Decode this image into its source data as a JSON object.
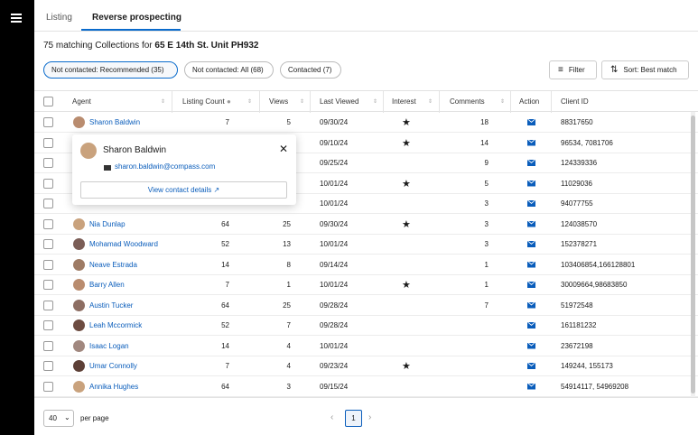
{
  "nav": {
    "menu_icon": "hamburger-icon"
  },
  "tabs": [
    {
      "label": "Listing",
      "active": false
    },
    {
      "label": "Reverse prospecting",
      "active": true
    }
  ],
  "summary": {
    "prefix": "75 matching Collections for",
    "address": "65 E 14th St. Unit PH932"
  },
  "filters": [
    {
      "label": "Not contacted: Recommended (35)",
      "active": true
    },
    {
      "label": "Not contacted: All (68)",
      "active": false
    },
    {
      "label": "Contacted (7)",
      "active": false
    }
  ],
  "toolbar": {
    "filter_label": "Filter",
    "sort_label": "Sort: Best match"
  },
  "columns": {
    "agent": "Agent",
    "listing_count": "Listing Count",
    "views": "Views",
    "last_viewed": "Last Viewed",
    "interest": "Interest",
    "comments": "Comments",
    "action": "Action",
    "client_id": "Client ID"
  },
  "rows": [
    {
      "agent": "Sharon Baldwin",
      "listing_count": "7",
      "views": "5",
      "last_viewed": "09/30/24",
      "interest": true,
      "comments": "18",
      "client_id": "88317650"
    },
    {
      "agent": "",
      "listing_count": "",
      "views": "",
      "last_viewed": "09/10/24",
      "interest": true,
      "comments": "14",
      "client_id": "96534, 7081706"
    },
    {
      "agent": "",
      "listing_count": "",
      "views": "",
      "last_viewed": "09/25/24",
      "interest": false,
      "comments": "9",
      "client_id": "124339336"
    },
    {
      "agent": "",
      "listing_count": "",
      "views": "",
      "last_viewed": "10/01/24",
      "interest": true,
      "comments": "5",
      "client_id": "11029036"
    },
    {
      "agent": "",
      "listing_count": "",
      "views": "",
      "last_viewed": "10/01/24",
      "interest": false,
      "comments": "3",
      "client_id": "94077755"
    },
    {
      "agent": "Nia Dunlap",
      "listing_count": "64",
      "views": "25",
      "last_viewed": "09/30/24",
      "interest": true,
      "comments": "3",
      "client_id": "124038570"
    },
    {
      "agent": "Mohamad Woodward",
      "listing_count": "52",
      "views": "13",
      "last_viewed": "10/01/24",
      "interest": false,
      "comments": "3",
      "client_id": "152378271"
    },
    {
      "agent": "Neave Estrada",
      "listing_count": "14",
      "views": "8",
      "last_viewed": "09/14/24",
      "interest": false,
      "comments": "1",
      "client_id": "103406854,166128801"
    },
    {
      "agent": "Barry Allen",
      "listing_count": "7",
      "views": "1",
      "last_viewed": "10/01/24",
      "interest": true,
      "comments": "1",
      "client_id": "30009664,98683850"
    },
    {
      "agent": "Austin Tucker",
      "listing_count": "64",
      "views": "25",
      "last_viewed": "09/28/24",
      "interest": false,
      "comments": "7",
      "client_id": "51972548"
    },
    {
      "agent": "Leah Mccormick",
      "listing_count": "52",
      "views": "7",
      "last_viewed": "09/28/24",
      "interest": false,
      "comments": "",
      "client_id": "161181232"
    },
    {
      "agent": "Isaac Logan",
      "listing_count": "14",
      "views": "4",
      "last_viewed": "10/01/24",
      "interest": false,
      "comments": "",
      "client_id": "23672198"
    },
    {
      "agent": "Umar Connolly",
      "listing_count": "7",
      "views": "4",
      "last_viewed": "09/23/24",
      "interest": true,
      "comments": "",
      "client_id": "149244, 155173"
    },
    {
      "agent": "Annika Hughes",
      "listing_count": "64",
      "views": "3",
      "last_viewed": "09/15/24",
      "interest": false,
      "comments": "",
      "client_id": "54914117, 54969208"
    }
  ],
  "popover": {
    "name": "Sharon Baldwin",
    "email": "sharon.baldwin@compass.com",
    "button": "View contact details"
  },
  "pagination": {
    "per_page": "40",
    "per_page_label": "per page",
    "current_page": "1"
  },
  "colors": {
    "accent": "#0a6bcc",
    "link": "#0a5dbb",
    "sidebar": "#000000"
  }
}
